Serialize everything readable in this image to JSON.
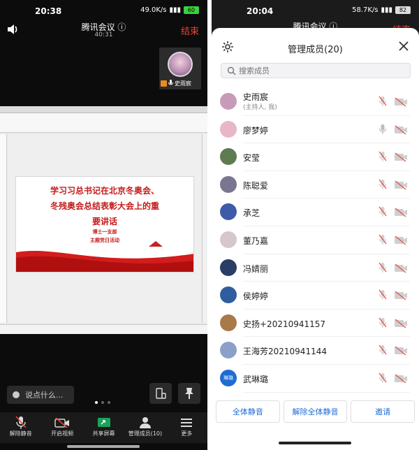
{
  "left": {
    "status": {
      "time": "20:38",
      "speed": "49.0K/s",
      "battery": "60"
    },
    "meeting_title": "腾讯会议",
    "timer": "40:31",
    "end_label": "结束",
    "video_tile_name": "史雨宸",
    "slide": {
      "line1": "学习习总书记在北京冬奥会、",
      "line2": "冬残奥会总结表彰大会上的重",
      "line3": "要讲话",
      "sub1": "博士一支部",
      "sub2": "主题党日活动"
    },
    "chat_placeholder": "说点什么...",
    "toolbar": [
      {
        "label": "解除静音",
        "icon": "mic-muted-icon"
      },
      {
        "label": "开启视频",
        "icon": "camera-off-icon"
      },
      {
        "label": "共享屏幕",
        "icon": "share-screen-icon"
      },
      {
        "label": "管理成员(10)",
        "icon": "members-icon"
      },
      {
        "label": "更多",
        "icon": "more-icon"
      }
    ]
  },
  "right": {
    "status": {
      "time": "20:04",
      "speed": "58.7K/s",
      "battery": "82"
    },
    "meeting_title": "腾讯会议",
    "end_label": "结束",
    "panel_title": "管理成员(20)",
    "search_placeholder": "搜索成员",
    "members": [
      {
        "name": "史雨宸",
        "sub": "(主持人, 我)",
        "avatar_color": "#c79bb8"
      },
      {
        "name": "廖梦婷",
        "sub": "",
        "avatar_color": "#e7b7c8"
      },
      {
        "name": "安莹",
        "sub": "",
        "avatar_color": "#5e7b52"
      },
      {
        "name": "陈聪爱",
        "sub": "",
        "avatar_color": "#7a7590"
      },
      {
        "name": "承芝",
        "sub": "",
        "avatar_color": "#3d5ba8"
      },
      {
        "name": "董乃嘉",
        "sub": "",
        "avatar_color": "#d6c6cd"
      },
      {
        "name": "冯婧丽",
        "sub": "",
        "avatar_color": "#2a3d66"
      },
      {
        "name": "侯婷婷",
        "sub": "",
        "avatar_color": "#2f5d9e"
      },
      {
        "name": "史扬+20210941157",
        "sub": "",
        "avatar_color": "#a87a4a"
      },
      {
        "name": "王海芳20210941144",
        "sub": "",
        "avatar_color": "#8aa0c8"
      },
      {
        "name": "武琳璐",
        "sub": "",
        "avatar_color": "#1f6bd4",
        "initials": "琳璐"
      }
    ],
    "actions": {
      "mute_all": "全体静音",
      "unmute_all": "解除全体静音",
      "invite": "邀请"
    }
  }
}
